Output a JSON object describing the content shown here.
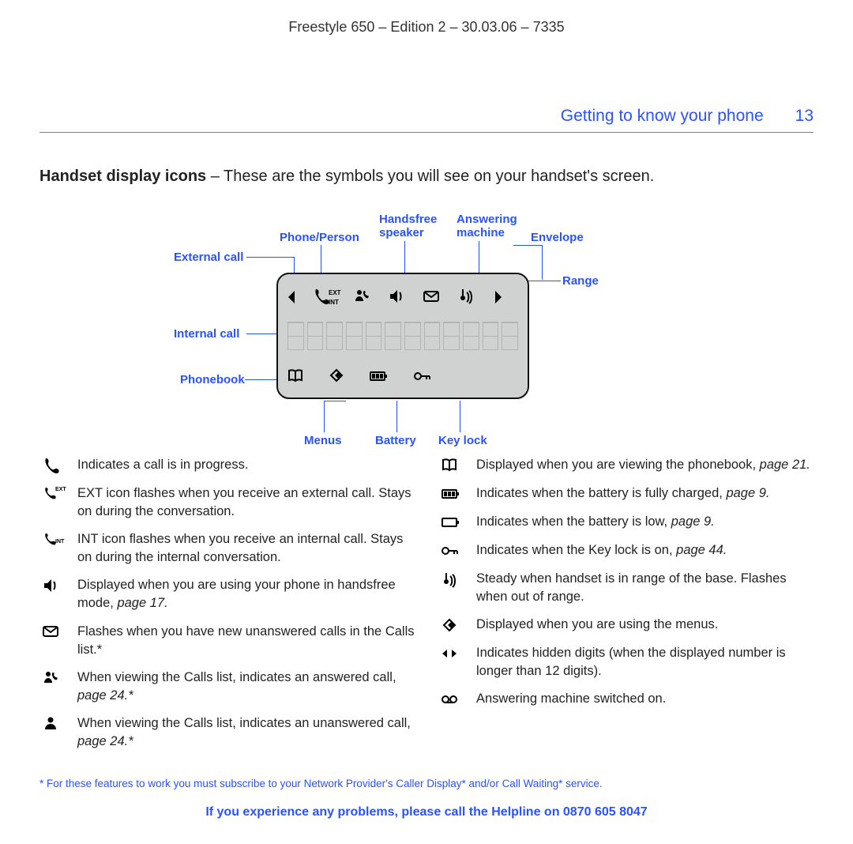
{
  "doc_header": "Freestyle 650 – Edition 2 – 30.03.06 – 7335",
  "running_section": "Getting to know your phone",
  "page_number": "13",
  "intro_bold": "Handset display icons",
  "intro_rest": " – These are the symbols you will see on your handset's screen.",
  "callouts": {
    "external_call": "External call",
    "internal_call": "Internal call",
    "phonebook": "Phonebook",
    "phone_person": "Phone/Person",
    "handsfree": "Handsfree speaker",
    "answering": "Answering machine",
    "envelope": "Envelope",
    "range": "Range",
    "menus": "Menus",
    "battery": "Battery",
    "keylock": "Key lock"
  },
  "legend_left": [
    {
      "icon": "call",
      "text": "Indicates a call is in progress."
    },
    {
      "icon": "ext",
      "text": "EXT icon flashes when you receive an external call. Stays on during the conversation."
    },
    {
      "icon": "int",
      "text": "INT icon flashes when you receive an internal call. Stays on during the internal conversation."
    },
    {
      "icon": "speaker",
      "text": "Displayed when you are using your phone in handsfree mode, ",
      "ital": "page 17."
    },
    {
      "icon": "envelope",
      "text": "Flashes when you have new unanswered calls in the Calls list.*"
    },
    {
      "icon": "person-phone",
      "text": "When viewing the Calls list, indicates an answered call, ",
      "ital": "page 24.*"
    },
    {
      "icon": "person",
      "text": "When viewing the Calls list, indicates an unanswered call, ",
      "ital": "page 24.*"
    }
  ],
  "legend_right": [
    {
      "icon": "book",
      "text": "Displayed when you are viewing the phonebook, ",
      "ital": "page 21."
    },
    {
      "icon": "batt-full",
      "text": "Indicates when the battery is fully charged, ",
      "ital": "page 9."
    },
    {
      "icon": "batt-low",
      "text": "Indicates when the battery is low, ",
      "ital": "page 9."
    },
    {
      "icon": "key",
      "text": "Indicates when the Key lock is on, ",
      "ital": "page 44."
    },
    {
      "icon": "range",
      "text": "Steady when handset is in range of the base. Flashes when out of range."
    },
    {
      "icon": "menu",
      "text": "Displayed when you are using the menus."
    },
    {
      "icon": "arrows",
      "text": "Indicates hidden digits (when the displayed number is longer than 12 digits)."
    },
    {
      "icon": "tape",
      "text": "Answering machine switched on."
    }
  ],
  "footnote": "* For these features to work you must subscribe to your Network Provider's Caller Display* and/or Call Waiting* service.",
  "helpline_a": "If you experience any problems, please call the Helpline on ",
  "helpline_b": "0870 605 8047"
}
